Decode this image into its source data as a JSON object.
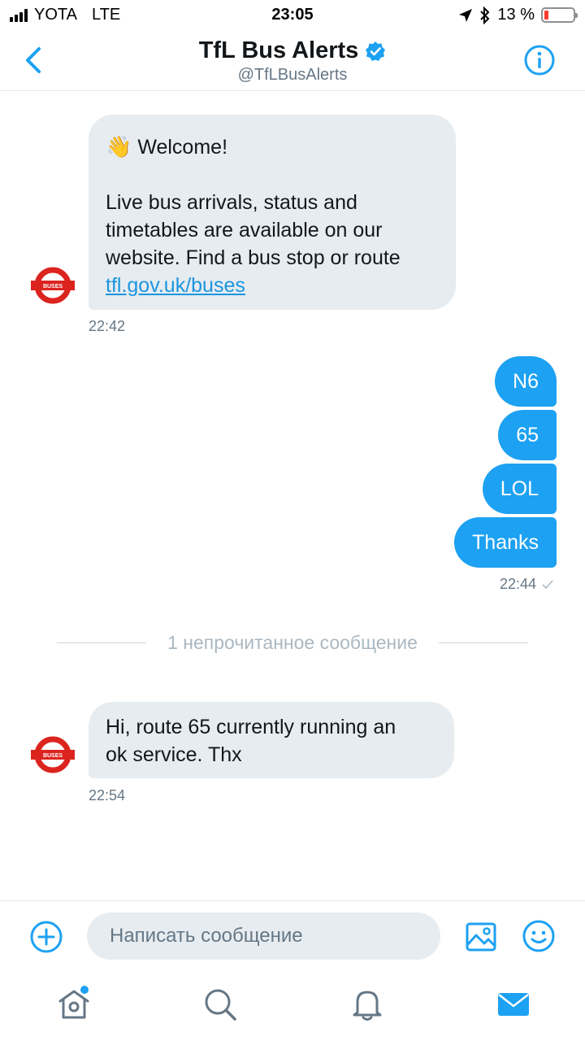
{
  "status_bar": {
    "carrier": "YOTA",
    "network": "LTE",
    "time": "23:05",
    "battery": "13 %",
    "battery_level": 0.13
  },
  "header": {
    "title": "TfL Bus Alerts",
    "handle": "@TfLBusAlerts",
    "verified": true,
    "back_icon": "chevron-left-icon",
    "info_icon": "info-icon"
  },
  "avatar": {
    "label": "BUSES",
    "ring_color": "#dc241f",
    "bar_color": "#dc241f"
  },
  "messages": {
    "welcome": {
      "emoji": "👋",
      "greeting": "Welcome!",
      "line1": "Live bus arrivals, status and",
      "line2": "timetables are available on our",
      "line3": "website. Find a bus stop or route",
      "link": "tfl.gov.uk/buses",
      "time": "22:42"
    },
    "sent": [
      "N6",
      "65",
      "LOL",
      "Thanks"
    ],
    "sent_time": "22:44",
    "unread_divider": "1 непрочитанное сообщение",
    "reply": {
      "line1": "Hi, route 65 currently running an",
      "line2": "ok service. Thx",
      "time": "22:54"
    }
  },
  "composer": {
    "placeholder": "Написать сообщение",
    "add_icon": "plus-circle-icon",
    "image_icon": "image-icon",
    "emoji_icon": "smiley-icon"
  },
  "tabs": [
    "home-icon",
    "search-icon",
    "notifications-icon",
    "messages-icon"
  ],
  "colors": {
    "accent": "#1da1f2",
    "bubble_in": "#e6ecf0",
    "text_secondary": "#657786"
  }
}
